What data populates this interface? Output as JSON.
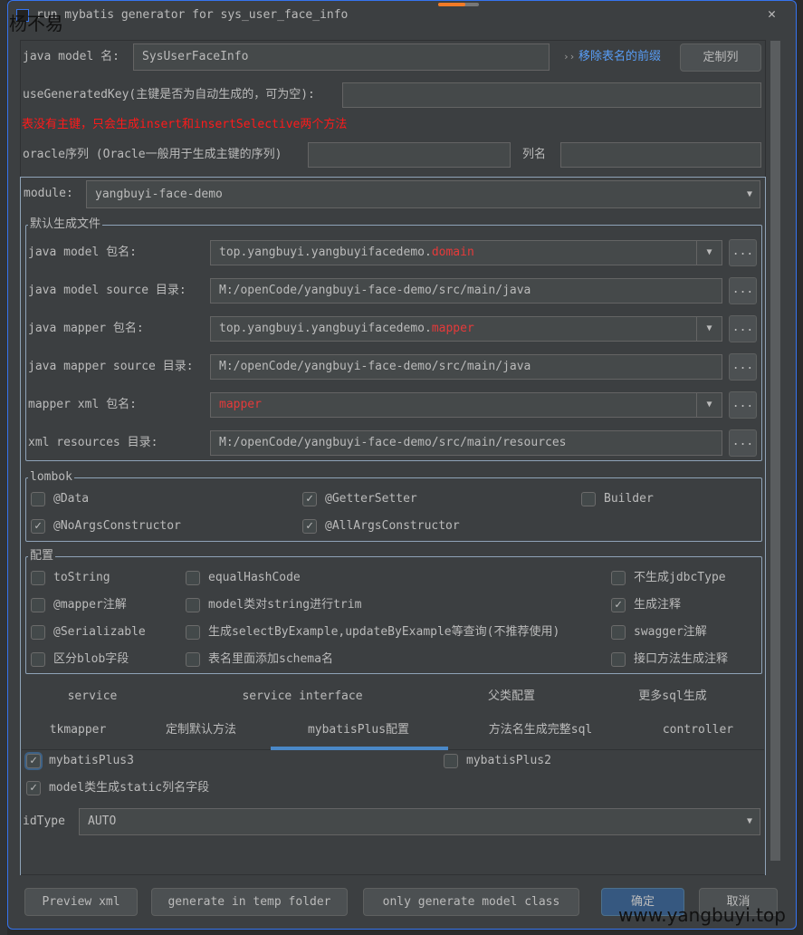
{
  "window": {
    "title": "run mybatis generator for sys_user_face_info",
    "close": "✕"
  },
  "watermark": {
    "top": "杨不易",
    "bottom": "www.yangbuyi.top"
  },
  "model": {
    "label": "java model 名:",
    "value": "SysUserFaceInfo",
    "link_arrows": "››",
    "link": "移除表名的前缀",
    "custom_btn": "定制列"
  },
  "generatedKey": {
    "label": "useGeneratedKey(主键是否为自动生成的，可为空):",
    "value": ""
  },
  "warning": "表没有主键，只会生成insert和insertSelective两个方法",
  "oracle": {
    "label": "oracle序列 (Oracle一般用于生成主键的序列)",
    "value": "",
    "col_label": "列名",
    "col_value": ""
  },
  "module": {
    "label": "module:",
    "value": "yangbuyi-face-demo"
  },
  "files": {
    "title": "默认生成文件",
    "rows": [
      {
        "label": "java model 包名:",
        "prefix": "top.yangbuyi.yangbuyifacedemo.",
        "suffix": "domain",
        "combo": true
      },
      {
        "label": "java model source 目录:",
        "prefix": "M:/openCode/yangbuyi-face-demo/src/main/java",
        "suffix": "",
        "combo": false
      },
      {
        "label": "java mapper 包名:",
        "prefix": "top.yangbuyi.yangbuyifacedemo.",
        "suffix": "mapper",
        "combo": true
      },
      {
        "label": "java mapper source 目录:",
        "prefix": "M:/openCode/yangbuyi-face-demo/src/main/java",
        "suffix": "",
        "combo": false
      },
      {
        "label": "mapper xml 包名:",
        "prefix": "",
        "suffix": "mapper",
        "combo": true
      },
      {
        "label": "xml resources 目录:",
        "prefix": "M:/openCode/yangbuyi-face-demo/src/main/resources",
        "suffix": "",
        "combo": false
      }
    ],
    "browse": "..."
  },
  "lombok": {
    "title": "lombok",
    "items": [
      {
        "label": "@Data",
        "checked": false
      },
      {
        "label": "@GetterSetter",
        "checked": true
      },
      {
        "label": "Builder",
        "checked": false
      },
      {
        "label": "@NoArgsConstructor",
        "checked": true
      },
      {
        "label": "@AllArgsConstructor",
        "checked": true
      }
    ]
  },
  "config": {
    "title": "配置",
    "items": [
      {
        "label": "toString",
        "checked": false
      },
      {
        "label": "equalHashCode",
        "checked": false
      },
      {
        "label": "不生成jdbcType",
        "checked": false
      },
      {
        "label": "@mapper注解",
        "checked": false
      },
      {
        "label": "model类对string进行trim",
        "checked": false
      },
      {
        "label": "生成注释",
        "checked": true
      },
      {
        "label": "@Serializable",
        "checked": false
      },
      {
        "label": "生成selectByExample,updateByExample等查询(不推荐使用)",
        "checked": false
      },
      {
        "label": "swagger注解",
        "checked": false
      },
      {
        "label": "区分blob字段",
        "checked": false
      },
      {
        "label": "表名里面添加schema名",
        "checked": false
      },
      {
        "label": "接口方法生成注释",
        "checked": false
      }
    ]
  },
  "tabs": {
    "row1": [
      "service",
      "service interface",
      "父类配置",
      "更多sql生成"
    ],
    "row2": [
      "tkmapper",
      "定制默认方法",
      "mybatisPlus配置",
      "方法名生成完整sql",
      "controller"
    ],
    "selected": "mybatisPlus配置"
  },
  "plus": {
    "items": [
      {
        "label": "mybatisPlus3",
        "checked": true
      },
      {
        "label": "mybatisPlus2",
        "checked": false
      },
      {
        "label": "model类生成static列名字段",
        "checked": true
      }
    ],
    "idType_label": "idType",
    "idType_value": "AUTO"
  },
  "buttons": {
    "preview": "Preview xml",
    "temp": "generate in temp folder",
    "model_only": "only generate model class",
    "ok": "确定",
    "cancel": "取消"
  },
  "colors": {
    "accent": "#3574f0",
    "link": "#589df6",
    "warning": "#ff0000",
    "ok_button": "#365880",
    "tab_underline": "#4a88c7"
  }
}
